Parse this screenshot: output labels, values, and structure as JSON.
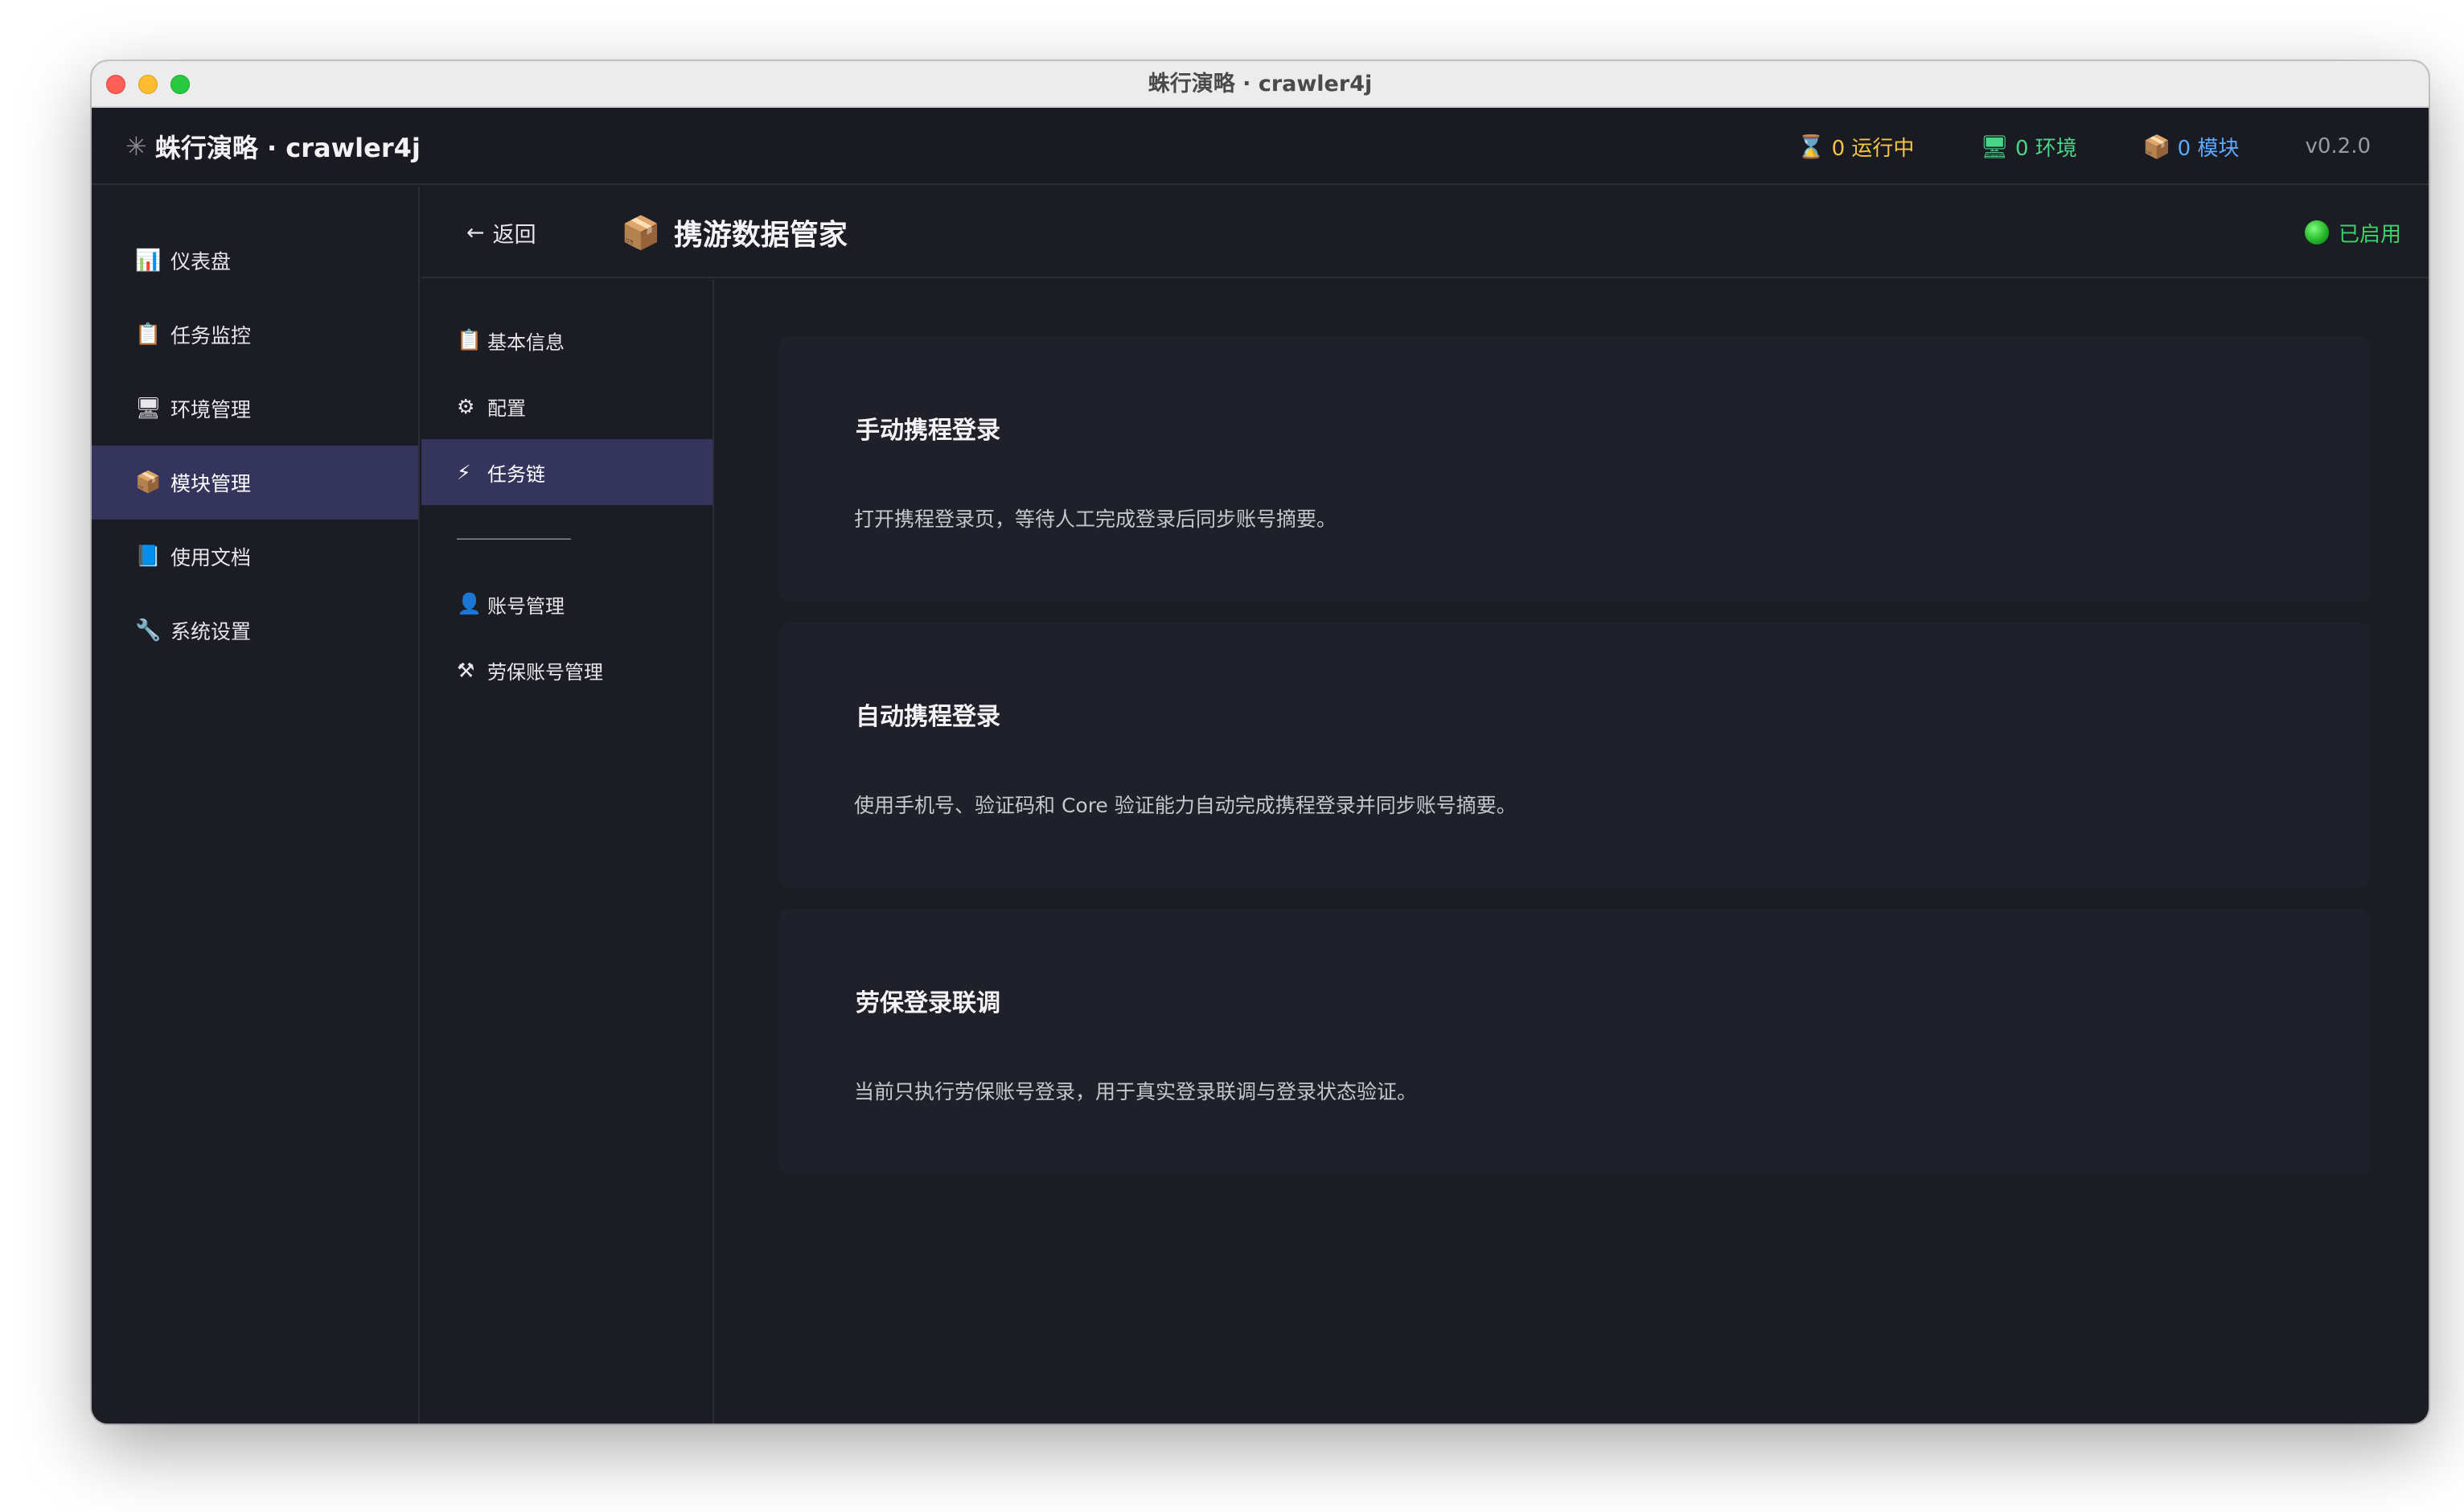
{
  "window": {
    "title": "蛛行演略 · crawler4j"
  },
  "appbar": {
    "brand_icon": "spider-icon",
    "brand": "蛛行演略 · crawler4j",
    "stats": {
      "running": "0 运行中",
      "env": "0 环境",
      "modules": "0 模块"
    },
    "version": "v0.2.0",
    "colors": {
      "running": "#f5c542",
      "env": "#4cd486",
      "modules": "#5aa8ff"
    }
  },
  "sidebar": {
    "items": [
      {
        "label": "仪表盘",
        "icon": "bar-chart-icon"
      },
      {
        "label": "任务监控",
        "icon": "clipboard-icon"
      },
      {
        "label": "环境管理",
        "icon": "monitor-icon"
      },
      {
        "label": "模块管理",
        "icon": "package-icon",
        "active": true
      },
      {
        "label": "使用文档",
        "icon": "book-icon"
      },
      {
        "label": "系统设置",
        "icon": "wrench-icon"
      }
    ]
  },
  "header": {
    "back_label": "返回",
    "title": "携游数据管家",
    "title_icon": "package-icon",
    "status": "已启用",
    "status_color": "#3ed36a"
  },
  "subnav": {
    "items": [
      {
        "label": "基本信息",
        "icon": "clipboard-icon"
      },
      {
        "label": "配置",
        "icon": "gear-icon"
      },
      {
        "label": "任务链",
        "icon": "lightning-icon",
        "active": true
      },
      {
        "label": "账号管理",
        "icon": "user-icon"
      },
      {
        "label": "劳保账号管理",
        "icon": "tools-icon"
      }
    ],
    "divider": "———————"
  },
  "tasks": [
    {
      "title": "手动携程登录",
      "desc": "打开携程登录页，等待人工完成登录后同步账号摘要。"
    },
    {
      "title": "自动携程登录",
      "desc": "使用手机号、验证码和 Core 验证能力自动完成携程登录并同步账号摘要。"
    },
    {
      "title": "劳保登录联调",
      "desc": "当前只执行劳保账号登录，用于真实登录联调与登录状态验证。"
    }
  ]
}
